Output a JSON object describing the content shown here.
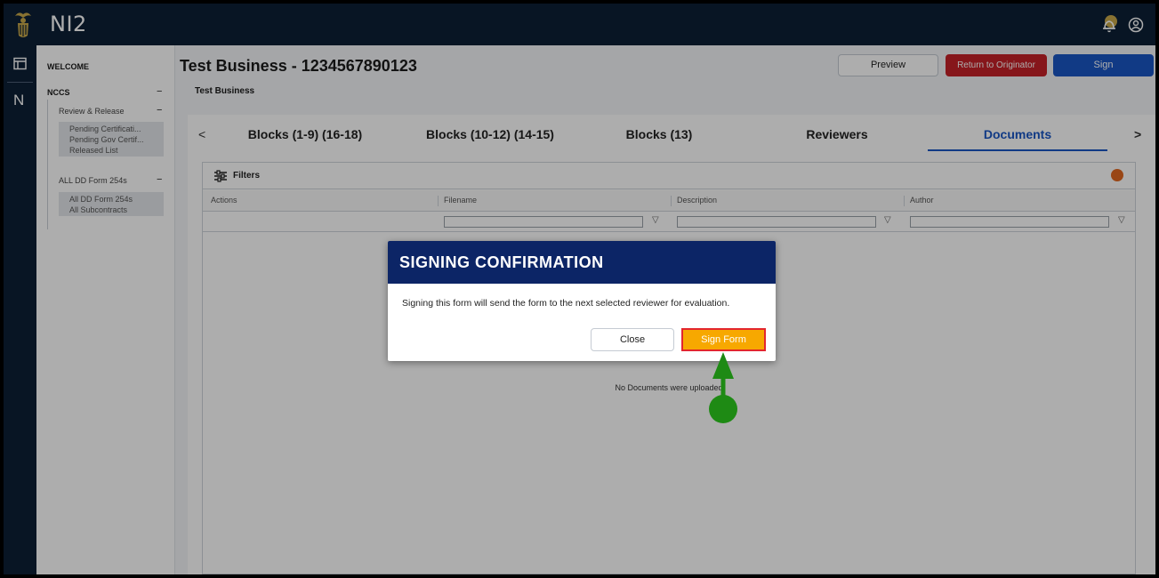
{
  "app": {
    "name": "NI2"
  },
  "rail": {
    "letter": "N"
  },
  "sidebar": {
    "welcome": "WELCOME",
    "nccs": "NCCS",
    "collapse_symbol": "−",
    "review_release": {
      "label": "Review & Release",
      "items": [
        "Pending Certificati...",
        "Pending Gov Certif...",
        "Released List"
      ]
    },
    "all_dd": {
      "label": "ALL DD Form 254s",
      "items": [
        "All DD Form 254s",
        "All Subcontracts"
      ]
    }
  },
  "header": {
    "title": "Test Business - 1234567890123",
    "subtitle": "Test Business",
    "preview_label": "Preview",
    "return_label": "Return to Originator",
    "sign_label": "Sign"
  },
  "tabs": {
    "prev_symbol": "<",
    "next_symbol": ">",
    "items": [
      {
        "label": "Blocks (1-9) (16-18)"
      },
      {
        "label": "Blocks (10-12) (14-15)"
      },
      {
        "label": "Blocks (13)"
      },
      {
        "label": "Reviewers"
      },
      {
        "label": "Documents",
        "active": true
      }
    ]
  },
  "grid": {
    "filters_label": "Filters",
    "columns": [
      "Actions",
      "Filename",
      "Description",
      "Author"
    ],
    "filter_icon_symbol": "▽",
    "empty_message": "No Documents were uploaded"
  },
  "modal": {
    "title": "SIGNING CONFIRMATION",
    "message": "Signing this form will send the form to the next selected reviewer for evaluation.",
    "close_label": "Close",
    "sign_form_label": "Sign Form"
  },
  "colors": {
    "navy": "#0c1f36",
    "modal_header": "#0c2566",
    "accent_blue": "#1a56c4",
    "return_red": "#c62128",
    "sign_form_orange": "#f7a800",
    "highlight_red": "#e3262d",
    "annotation_green": "#1e8a14"
  }
}
